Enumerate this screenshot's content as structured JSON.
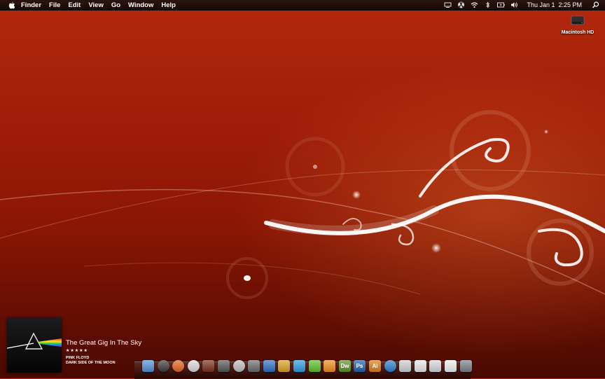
{
  "menubar": {
    "app_name": "Finder",
    "menus": [
      "File",
      "Edit",
      "View",
      "Go",
      "Window",
      "Help"
    ],
    "status_icons": [
      "display-icon",
      "radiation-icon",
      "wifi-icon",
      "bluetooth-icon",
      "battery-icon",
      "volume-icon"
    ],
    "clock": "Thu Jan 1  2:25 PM"
  },
  "desktop": {
    "disk_label": "Macintosh HD"
  },
  "now_playing": {
    "title": "The Great Gig In The Sky",
    "rating": "★★★★★",
    "artist": "PINK FLOYD",
    "album": "DARK SIDE OF THE MOON"
  },
  "dock": {
    "apps": [
      {
        "name": "finder-icon",
        "label": "",
        "color": "#4f8fd6"
      },
      {
        "name": "dashboard-icon",
        "label": "",
        "color": "#3a3a3a"
      },
      {
        "name": "firefox-icon",
        "label": "",
        "color": "#e2631b"
      },
      {
        "name": "robot-icon",
        "label": "",
        "color": "#d8d8d8"
      },
      {
        "name": "crosshair-icon",
        "label": "",
        "color": "#7a2f1a"
      },
      {
        "name": "hat-icon",
        "label": "",
        "color": "#555555"
      },
      {
        "name": "helmet-icon",
        "label": "",
        "color": "#bdbdbd"
      },
      {
        "name": "grid-icon",
        "label": "",
        "color": "#6a6a6a"
      },
      {
        "name": "compass-icon",
        "label": "",
        "color": "#2f6fbf"
      },
      {
        "name": "guitar-icon",
        "label": "",
        "color": "#d9a020"
      },
      {
        "name": "cloud-icon",
        "label": "",
        "color": "#2a9be0"
      },
      {
        "name": "leaf-icon",
        "label": "",
        "color": "#5abf2a"
      },
      {
        "name": "blob-icon",
        "label": "",
        "color": "#f08a1a"
      },
      {
        "name": "dreamweaver-icon",
        "label": "Dw",
        "color": "#5f8f2a"
      },
      {
        "name": "photoshop-icon",
        "label": "Ps",
        "color": "#1f5fa8"
      },
      {
        "name": "illustrator-icon",
        "label": "Ai",
        "color": "#e07a10"
      },
      {
        "name": "sync-icon",
        "label": "",
        "color": "#2a7fd0"
      },
      {
        "name": "stand-icon",
        "label": "",
        "color": "#cfcfcf"
      },
      {
        "name": "document-icon",
        "label": "",
        "color": "#e8e8e8"
      },
      {
        "name": "preview-icon",
        "label": "",
        "color": "#d6d6d6"
      },
      {
        "name": "monitor-icon",
        "label": "",
        "color": "#f0f0f0"
      },
      {
        "name": "trash-icon",
        "label": "",
        "color": "#7a7f88"
      }
    ]
  }
}
